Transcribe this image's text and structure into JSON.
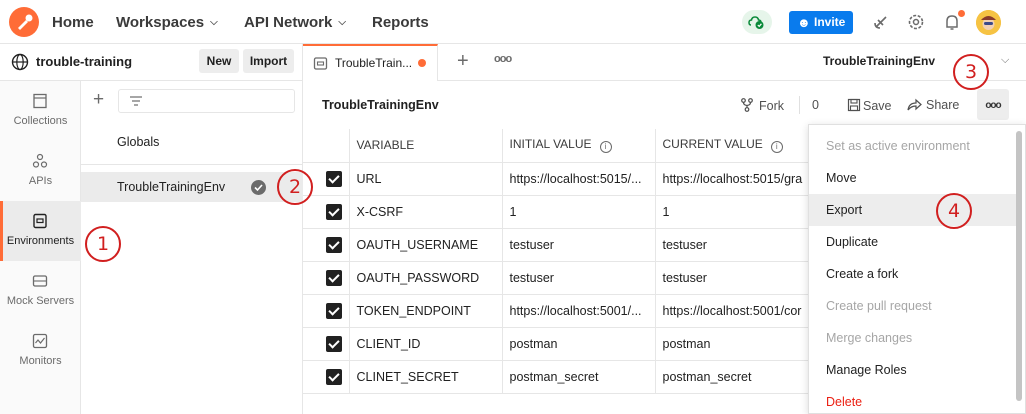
{
  "topbar": {
    "nav": [
      {
        "label": "Home",
        "has_dropdown": false
      },
      {
        "label": "Workspaces",
        "has_dropdown": true
      },
      {
        "label": "API Network",
        "has_dropdown": true
      },
      {
        "label": "Reports",
        "has_dropdown": false
      }
    ],
    "invite_label": "Invite",
    "icons": [
      "sync-status-icon",
      "user-plus-icon",
      "satellite-icon",
      "settings-icon",
      "bell-icon",
      "avatar"
    ],
    "accent_color": "#ff6c37",
    "invite_color": "#097bed"
  },
  "workspace": {
    "name": "trouble-training",
    "new_label": "New",
    "import_label": "Import"
  },
  "tabs": [
    {
      "label": "TroubleTrain...",
      "unsaved": true
    }
  ],
  "environment_selector": "TroubleTrainingEnv",
  "sidebar": {
    "items": [
      {
        "label": "Collections",
        "icon": "collections-icon",
        "active": false
      },
      {
        "label": "APIs",
        "icon": "apis-icon",
        "active": false
      },
      {
        "label": "Environments",
        "icon": "environments-icon",
        "active": true
      },
      {
        "label": "Mock Servers",
        "icon": "mock-server-icon",
        "active": false
      },
      {
        "label": "Monitors",
        "icon": "monitors-icon",
        "active": false
      }
    ]
  },
  "env_list": {
    "items": [
      {
        "label": "Globals",
        "selected": false
      },
      {
        "label": "TroubleTrainingEnv",
        "selected": true
      }
    ]
  },
  "main": {
    "title": "TroubleTrainingEnv",
    "fork_label": "Fork",
    "fork_count": "0",
    "save_label": "Save",
    "share_label": "Share",
    "more_label": "ooo"
  },
  "table": {
    "headers": {
      "variable": "VARIABLE",
      "initial": "INITIAL VALUE",
      "current": "CURRENT VALUE"
    },
    "rows": [
      {
        "variable": "URL",
        "initial": "https://localhost:5015/...",
        "current": "https://localhost:5015/gra"
      },
      {
        "variable": "X-CSRF",
        "initial": "1",
        "current": "1"
      },
      {
        "variable": "OAUTH_USERNAME",
        "initial": "testuser",
        "current": "testuser"
      },
      {
        "variable": "OAUTH_PASSWORD",
        "initial": "testuser",
        "current": "testuser"
      },
      {
        "variable": "TOKEN_ENDPOINT",
        "initial": "https://localhost:5001/...",
        "current": "https://localhost:5001/cor"
      },
      {
        "variable": "CLIENT_ID",
        "initial": "postman",
        "current": "postman"
      },
      {
        "variable": "CLINET_SECRET",
        "initial": "postman_secret",
        "current": "postman_secret"
      }
    ]
  },
  "dropdown": {
    "items": [
      {
        "label": "Set as active environment",
        "state": "disabled"
      },
      {
        "label": "Move",
        "state": "normal"
      },
      {
        "label": "Export",
        "state": "hover"
      },
      {
        "label": "Duplicate",
        "state": "normal"
      },
      {
        "label": "Create a fork",
        "state": "normal"
      },
      {
        "label": "Create pull request",
        "state": "disabled"
      },
      {
        "label": "Merge changes",
        "state": "disabled"
      },
      {
        "label": "Manage Roles",
        "state": "normal"
      },
      {
        "label": "Delete",
        "state": "danger"
      }
    ]
  },
  "annotations": {
    "one": "1",
    "two": "2",
    "three": "3",
    "four": "4",
    "color": "#d11f1f"
  }
}
